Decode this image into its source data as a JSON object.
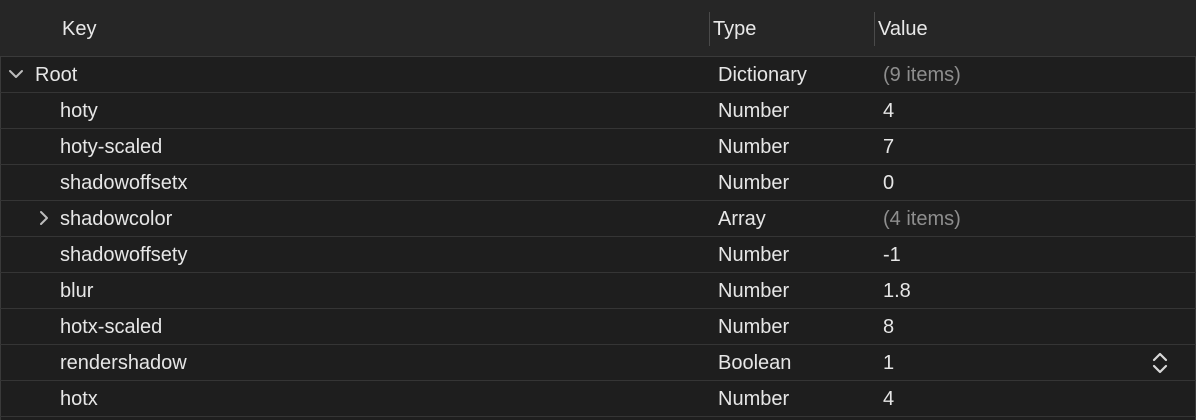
{
  "header": {
    "key_label": "Key",
    "type_label": "Type",
    "value_label": "Value"
  },
  "rows": [
    {
      "key": "Root",
      "type": "Dictionary",
      "value": "(9 items)",
      "disclosure": "chevron-down-icon",
      "muted": true
    },
    {
      "key": "hoty",
      "type": "Number",
      "value": "4"
    },
    {
      "key": "hoty-scaled",
      "type": "Number",
      "value": "7"
    },
    {
      "key": "shadowoffsetx",
      "type": "Number",
      "value": "0"
    },
    {
      "key": "shadowcolor",
      "type": "Array",
      "value": "(4 items)",
      "disclosure": "chevron-right-icon",
      "muted": true
    },
    {
      "key": "shadowoffsety",
      "type": "Number",
      "value": "-1"
    },
    {
      "key": "blur",
      "type": "Number",
      "value": "1.8"
    },
    {
      "key": "hotx-scaled",
      "type": "Number",
      "value": "8"
    },
    {
      "key": "rendershadow",
      "type": "Boolean",
      "value": "1",
      "stepper": "up-down-chevron-icon"
    },
    {
      "key": "hotx",
      "type": "Number",
      "value": "4"
    }
  ],
  "colors": {
    "background": "#1e1e1e",
    "header_background": "#262626",
    "text": "#e6e6e6",
    "muted_text": "#8e8e8e",
    "row_divider": "#353535"
  }
}
